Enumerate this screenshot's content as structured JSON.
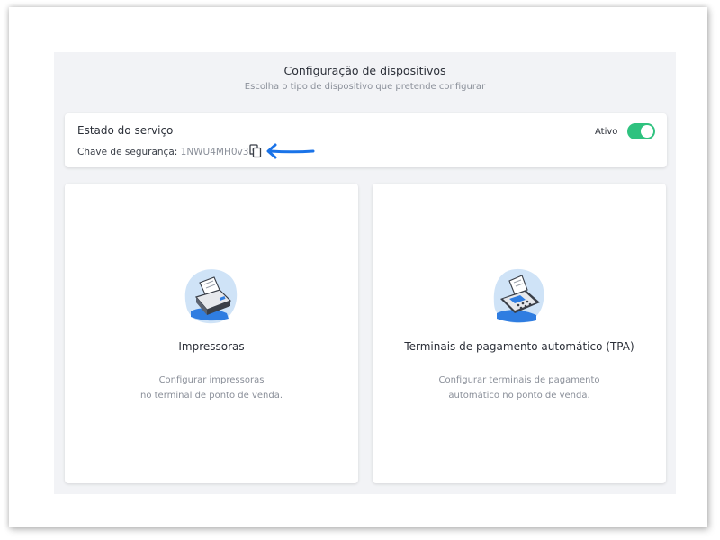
{
  "header": {
    "title": "Configuração de dispositivos",
    "subtitle": "Escolha o tipo de dispositivo que pretende configurar"
  },
  "service": {
    "title": "Estado do serviço",
    "key_label": "Chave de segurança: ",
    "key_value": "1NWU4MH0v3.9",
    "status_label": "Ativo",
    "status_on": true,
    "toggle_color": "#2fc27f",
    "copy_icon": "copy-icon",
    "annotation_arrow_color": "#1a73e8"
  },
  "devices": [
    {
      "icon": "printer-icon",
      "title": "Impressoras",
      "description_line1": "Configurar impressoras",
      "description_line2": "no terminal de ponto de venda."
    },
    {
      "icon": "payment-terminal-icon",
      "title": "Terminais de pagamento automático (TPA)",
      "description_line1": "Configurar terminais de pagamento",
      "description_line2": "automático no ponto de venda."
    }
  ],
  "colors": {
    "accent_blue": "#2f7de1",
    "illustration_blob": "#cfe3f7",
    "panel_bg": "#f2f3f6"
  }
}
